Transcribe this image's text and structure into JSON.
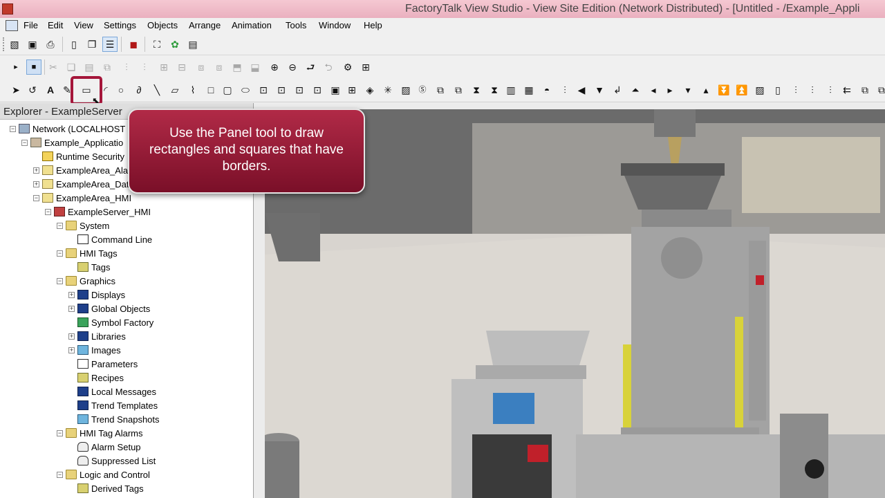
{
  "window": {
    "title": "FactoryTalk View Studio - View Site Edition (Network Distributed) - [Untitled - /Example_Appli"
  },
  "menu": {
    "items": [
      "File",
      "Edit",
      "View",
      "Settings",
      "Objects",
      "Arrange",
      "Animation",
      "Tools",
      "Window",
      "Help"
    ]
  },
  "explorer": {
    "header": "Explorer - ExampleServer",
    "tree": [
      {
        "label": "Network (LOCALHOST",
        "icon": "network-icon",
        "expander": "minus"
      },
      {
        "label": "Example_Applicatio",
        "icon": "application-icon",
        "expander": "minus"
      },
      {
        "label": "Runtime Security",
        "icon": "key-icon",
        "expander": ""
      },
      {
        "label": "ExampleArea_Ala",
        "icon": "area-icon",
        "expander": "plus"
      },
      {
        "label": "ExampleArea_Dat",
        "icon": "area-icon",
        "expander": "plus"
      },
      {
        "label": "ExampleArea_HMI",
        "icon": "area-icon",
        "expander": "minus"
      },
      {
        "label": "ExampleServer_HMI",
        "icon": "hmi-server-icon",
        "expander": "minus"
      },
      {
        "label": "System",
        "icon": "folder-icon",
        "expander": "minus"
      },
      {
        "label": "Command Line",
        "icon": "command-line-icon",
        "expander": ""
      },
      {
        "label": "HMI Tags",
        "icon": "folder-icon",
        "expander": "minus"
      },
      {
        "label": "Tags",
        "icon": "tags-icon",
        "expander": ""
      },
      {
        "label": "Graphics",
        "icon": "folder-icon",
        "expander": "minus"
      },
      {
        "label": "Displays",
        "icon": "displays-icon",
        "expander": "plus"
      },
      {
        "label": "Global Objects",
        "icon": "global-objects-icon",
        "expander": "plus"
      },
      {
        "label": "Symbol Factory",
        "icon": "symbol-factory-icon",
        "expander": ""
      },
      {
        "label": "Libraries",
        "icon": "libraries-icon",
        "expander": "plus"
      },
      {
        "label": "Images",
        "icon": "images-icon",
        "expander": "plus"
      },
      {
        "label": "Parameters",
        "icon": "parameters-icon",
        "expander": ""
      },
      {
        "label": "Recipes",
        "icon": "recipes-icon",
        "expander": ""
      },
      {
        "label": "Local Messages",
        "icon": "local-messages-icon",
        "expander": ""
      },
      {
        "label": "Trend Templates",
        "icon": "trend-templates-icon",
        "expander": ""
      },
      {
        "label": "Trend Snapshots",
        "icon": "trend-snapshots-icon",
        "expander": ""
      },
      {
        "label": "HMI Tag Alarms",
        "icon": "folder-icon",
        "expander": "minus"
      },
      {
        "label": "Alarm Setup",
        "icon": "alarm-setup-icon",
        "expander": ""
      },
      {
        "label": "Suppressed List",
        "icon": "suppressed-list-icon",
        "expander": ""
      },
      {
        "label": "Logic and Control",
        "icon": "folder-icon",
        "expander": "minus"
      },
      {
        "label": "Derived Tags",
        "icon": "derived-tags-icon",
        "expander": ""
      }
    ]
  },
  "callout": {
    "text": "Use the Panel tool to draw rectangles and squares that have borders."
  },
  "colors": {
    "titlebar": "#eab0bf",
    "callout": "#9a1a38",
    "highlight": "#a5163a"
  }
}
